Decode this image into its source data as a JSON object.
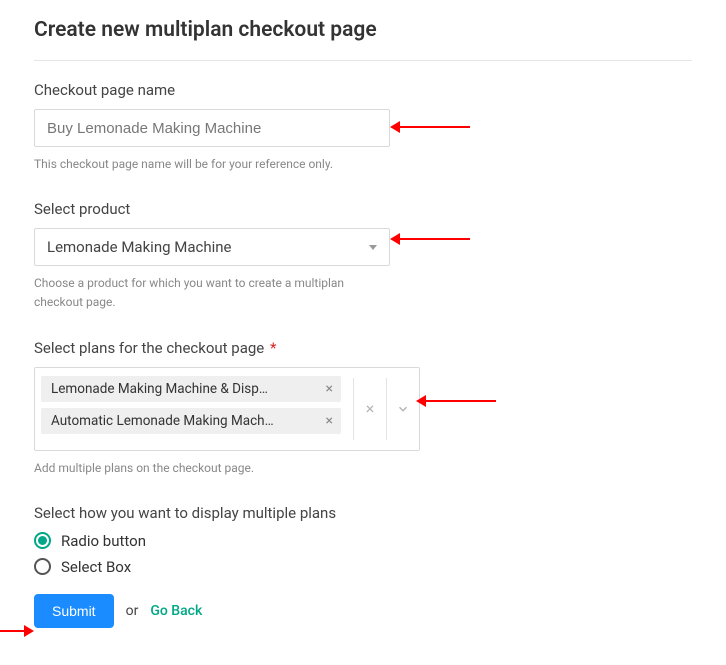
{
  "title": "Create new multiplan checkout page",
  "name_field": {
    "label": "Checkout page name",
    "value": "Buy Lemonade Making Machine",
    "help": "This checkout page name will be for your reference only."
  },
  "product_field": {
    "label": "Select product",
    "value": "Lemonade Making Machine",
    "help": "Choose a product for which you want to create a multiplan checkout page."
  },
  "plans_field": {
    "label": "Select plans for the checkout page",
    "required_mark": "*",
    "chips": [
      "Lemonade Making Machine & Disp…",
      "Automatic Lemonade Making Mach…"
    ],
    "help": "Add multiple plans on the checkout page."
  },
  "display_field": {
    "label": "Select how you want to display multiple plans",
    "options": [
      {
        "label": "Radio button",
        "selected": true
      },
      {
        "label": "Select Box",
        "selected": false
      }
    ]
  },
  "actions": {
    "submit": "Submit",
    "or": "or",
    "go_back": "Go Back"
  }
}
